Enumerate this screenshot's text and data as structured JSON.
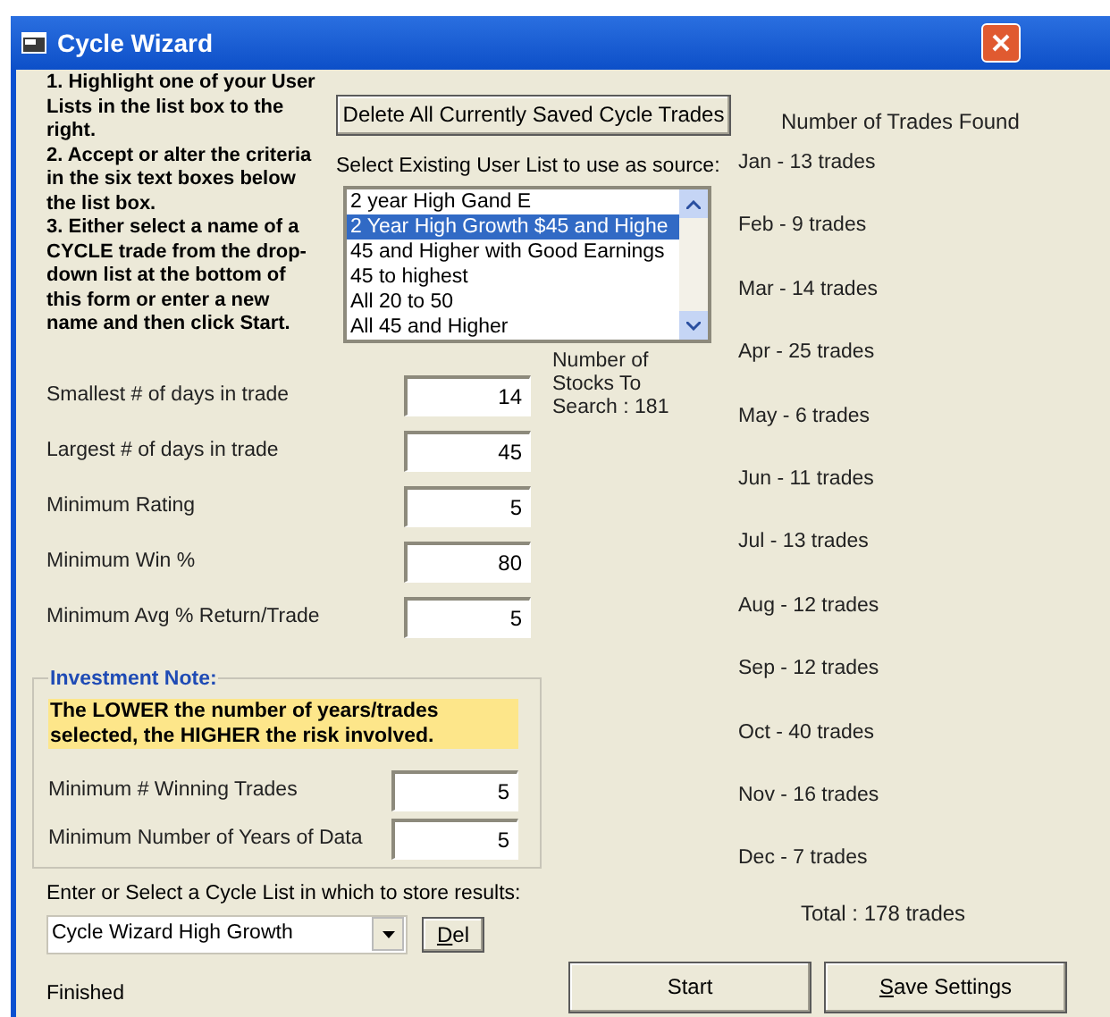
{
  "window": {
    "title": "Cycle Wizard"
  },
  "instructions": [
    "1.  Highlight one of your User Lists in the list box to the right.",
    "2.  Accept or alter the criteria in the six text boxes below the list box.",
    "3.  Either select a name of a CYCLE trade from the drop-down list at the bottom of this form or enter a new name and then click Start."
  ],
  "delete_button": "Delete All Currently Saved Cycle Trades",
  "source_label": "Select Existing User List to use as source:",
  "source_list": [
    {
      "label": "2 year High Gand E",
      "selected": false
    },
    {
      "label": "2 Year High Growth $45 and Highe",
      "selected": true
    },
    {
      "label": "45 and Higher with Good Earnings",
      "selected": false
    },
    {
      "label": "45 to highest",
      "selected": false
    },
    {
      "label": "All 20 to 50",
      "selected": false
    },
    {
      "label": "All 45 and Higher",
      "selected": false
    }
  ],
  "criteria": [
    {
      "label": "Smallest # of days in trade",
      "value": "14"
    },
    {
      "label": "Largest # of days in trade",
      "value": "45"
    },
    {
      "label": "Minimum Rating",
      "value": "5"
    },
    {
      "label": "Minimum Win %",
      "value": "80"
    },
    {
      "label": "Minimum Avg % Return/Trade",
      "value": "5"
    }
  ],
  "stocks_to_search": "Number of Stocks To Search : 181",
  "investment_note": {
    "title": "Investment Note:",
    "warning": "The LOWER the number of years/trades selected, the HIGHER the risk involved.",
    "criteria": [
      {
        "label": "Minimum # Winning Trades",
        "value": "5"
      },
      {
        "label": "Minimum Number of Years of Data",
        "value": "5"
      }
    ]
  },
  "cycle_list": {
    "label": "Enter or Select a Cycle List in which to store results:",
    "value": "Cycle Wizard High Growth",
    "delete_button": {
      "label": "Del",
      "underline_first": true
    }
  },
  "status": "Finished",
  "trades_found": {
    "title": "Number of Trades Found",
    "months": [
      "Jan - 13 trades",
      "Feb - 9 trades",
      "Mar - 14 trades",
      "Apr - 25 trades",
      "May - 6 trades",
      "Jun - 11 trades",
      "Jul - 13 trades",
      "Aug - 12 trades",
      "Sep - 12 trades",
      "Oct - 40 trades",
      "Nov - 16 trades",
      "Dec - 7 trades"
    ],
    "total": "Total : 178 trades"
  },
  "buttons": [
    {
      "label": "Start",
      "underline_first": false
    },
    {
      "label": "Save Settings",
      "underline_first": true
    }
  ]
}
